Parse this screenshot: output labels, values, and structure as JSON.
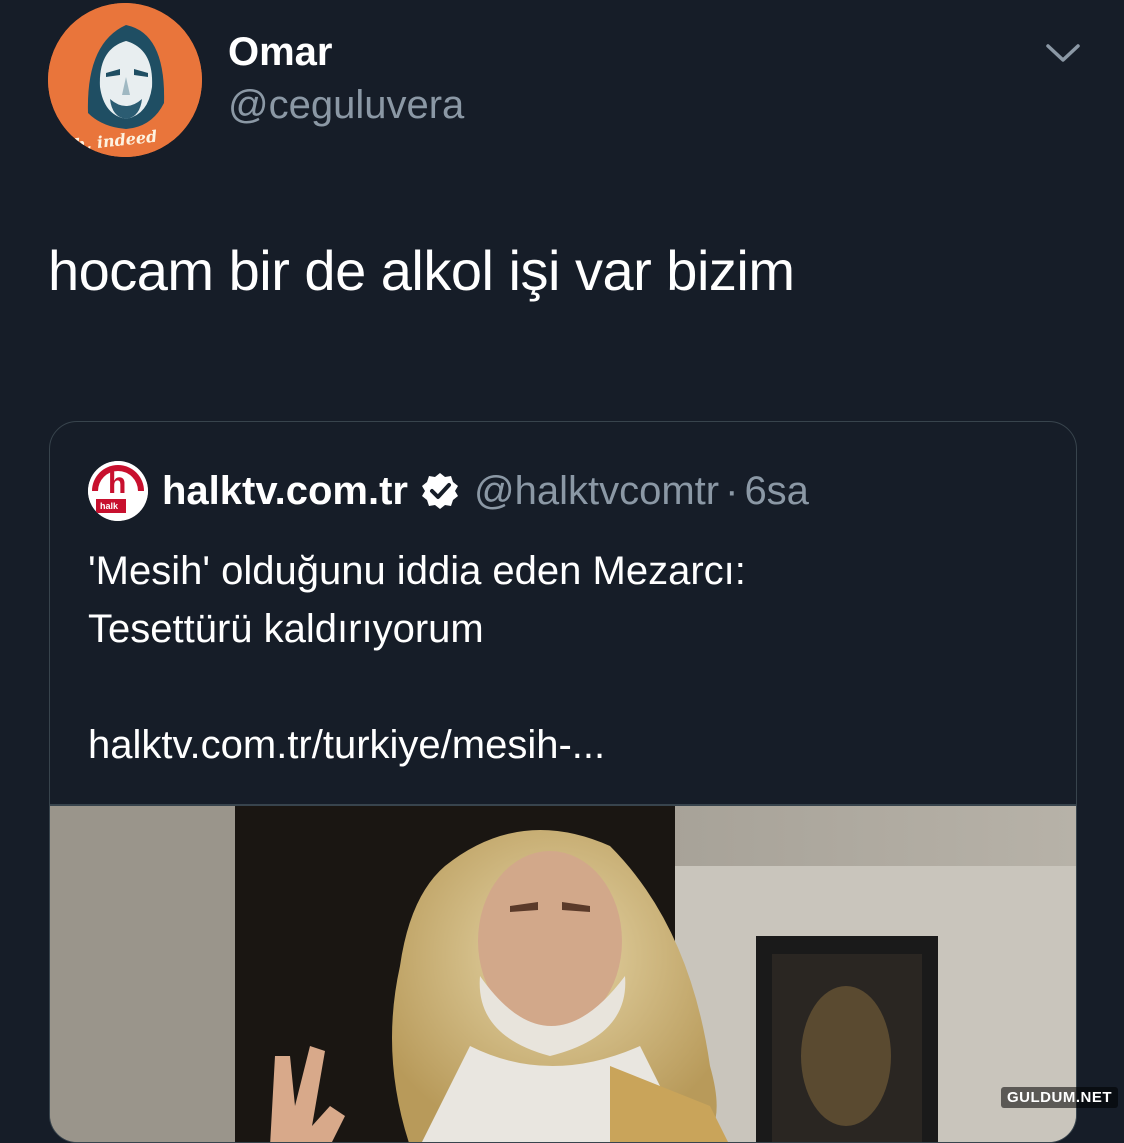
{
  "author": {
    "display_name": "Omar",
    "handle": "@ceguluvera",
    "avatar_caption": "h, indeed"
  },
  "tweet": {
    "text": "hocam bir de alkol işi var bizim"
  },
  "quoted_tweet": {
    "name": "halktv.com.tr",
    "handle": "@halktvcomtr",
    "separator": "·",
    "time": "6sa",
    "logo_letter": "h",
    "logo_caption": "halk",
    "body_line1": "'Mesih' olduğunu iddia eden Mezarcı:",
    "body_line2": "Tesettürü kaldırıyorum",
    "link": "halktv.com.tr/turkiye/mesih-..."
  },
  "watermark": "GULDUM.NET",
  "colors": {
    "background": "#161d28",
    "secondary_text": "#8b98a5",
    "border": "#38444d",
    "avatar_bg": "#e9753b",
    "brand_red": "#c8102e"
  }
}
